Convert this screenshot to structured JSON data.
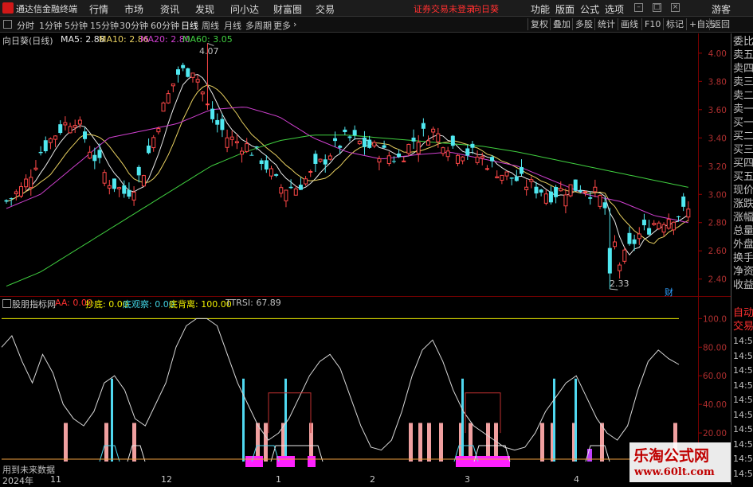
{
  "menubar": {
    "app_title": "通达信金融终端",
    "menus": [
      "行情",
      "市场",
      "资讯",
      "发现",
      "问小达",
      "财富圈",
      "交易"
    ],
    "warning": "证券交易未登录",
    "stock": "向日葵",
    "right": [
      "功能",
      "版面",
      "公式",
      "选项"
    ],
    "guest": "游客"
  },
  "toolbar": {
    "periods": [
      "分时",
      "1分钟",
      "5分钟",
      "15分钟",
      "30分钟",
      "60分钟",
      "日线",
      "周线",
      "月线",
      "多周期",
      "更多"
    ],
    "active_period": "日线",
    "right_buttons": [
      "复权",
      "叠加",
      "多股",
      "统计",
      "画线",
      "F10",
      "标记",
      "+自选",
      "返回"
    ]
  },
  "main_panel": {
    "title": "向日葵(日线)",
    "ma_legend": [
      {
        "label": "MA5: 2.88",
        "color": "#e8e8e8"
      },
      {
        "label": "MA10: 2.86",
        "color": "#e8d060"
      },
      {
        "label": "MA20: 2.80",
        "color": "#d040d0"
      },
      {
        "label": "MA60: 3.05",
        "color": "#40d040"
      }
    ],
    "high_label": "4.07",
    "low_label": "2.33",
    "y_ticks": [
      "4.00",
      "3.80",
      "3.60",
      "3.40",
      "3.20",
      "3.00",
      "2.80",
      "2.60",
      "2.40"
    ],
    "marker": "财"
  },
  "indicator_panel": {
    "name": "股朋指标网",
    "items": [
      {
        "label": "AA: 0.00",
        "color": "#ff3030"
      },
      {
        "label": "抄底: 0.00",
        "color": "#f0f000"
      },
      {
        "label": "底观察: 0.00",
        "color": "#40d0e0"
      },
      {
        "label": "底背离: 100.00",
        "color": "#f0f000"
      },
      {
        "label": "TTRSI: 67.89",
        "color": "#c0c0c0"
      }
    ],
    "y_ticks": [
      "100.0",
      "80.00",
      "60.00",
      "40.00",
      "20.00"
    ],
    "footer": "用到未来数据"
  },
  "x_axis": {
    "labels": [
      "2024年",
      "11",
      "12",
      "1",
      "2",
      "3",
      "4"
    ]
  },
  "right_panel": {
    "quote_labels": [
      "委比",
      "卖五",
      "卖四",
      "卖三",
      "卖二",
      "卖一",
      "买一",
      "买二",
      "买三",
      "买四",
      "买五",
      "现价",
      "涨跌",
      "涨幅",
      "总量",
      "外盘",
      "换手",
      "净资",
      "收益"
    ],
    "auto_trade": [
      "自动",
      "交易"
    ],
    "times": [
      "14:56",
      "14:56",
      "14:56",
      "14:56",
      "14:56",
      "14:56",
      "14:56",
      "14:56",
      "14:56",
      "14:56"
    ]
  },
  "watermark": {
    "line1": "乐淘公式网",
    "line2": "www.60lt.com"
  },
  "chart_data": [
    {
      "type": "candlestick",
      "title": "向日葵(日线)",
      "ylim": [
        2.28,
        4.14
      ],
      "x": [
        "2024-10-28",
        "2024-11-01",
        "2024-12-02",
        "2025-01-02",
        "2025-02-05",
        "2025-03-03",
        "2025-04-01"
      ],
      "annotations": {
        "high": 4.07,
        "low": 2.33
      },
      "series": [
        {
          "name": "MA5",
          "values": [
            2.88
          ]
        },
        {
          "name": "MA10",
          "values": [
            2.86
          ]
        },
        {
          "name": "MA20",
          "values": [
            2.8
          ]
        },
        {
          "name": "MA60",
          "values": [
            3.05
          ]
        }
      ],
      "close_trend": [
        2.95,
        3.05,
        3.3,
        3.45,
        3.55,
        3.3,
        3.1,
        3.0,
        3.15,
        3.55,
        3.85,
        3.9,
        3.55,
        3.4,
        3.35,
        3.25,
        3.05,
        3.05,
        3.15,
        3.3,
        3.4,
        3.35,
        3.3,
        3.25,
        3.4,
        3.45,
        3.35,
        3.3,
        3.25,
        3.15,
        3.1,
        3.05,
        3.0,
        3.05,
        3.05,
        2.95,
        2.5,
        2.7,
        2.8,
        2.85,
        2.88
      ],
      "ma60_trend": [
        2.35,
        2.45,
        2.6,
        2.75,
        2.9,
        3.05,
        3.2,
        3.3,
        3.38,
        3.42,
        3.42,
        3.4,
        3.38,
        3.36,
        3.34,
        3.3,
        3.25,
        3.2,
        3.15,
        3.1,
        3.05
      ],
      "ma20_trend": [
        2.9,
        3.0,
        3.2,
        3.4,
        3.45,
        3.5,
        3.6,
        3.62,
        3.55,
        3.4,
        3.3,
        3.25,
        3.28,
        3.3,
        3.25,
        3.2,
        3.1,
        3.0,
        2.95,
        2.85,
        2.8
      ],
      "ylabel": ""
    },
    {
      "type": "line",
      "title": "股朋指标网",
      "ylim": [
        0,
        108
      ],
      "series": [
        {
          "name": "TTRSI",
          "values": [
            80,
            88,
            70,
            55,
            75,
            62,
            40,
            30,
            25,
            35,
            55,
            60,
            50,
            30,
            25,
            40,
            55,
            80,
            95,
            100,
            100,
            95,
            75,
            55,
            40,
            25,
            15,
            20,
            30,
            45,
            60,
            70,
            75,
            65,
            45,
            25,
            10,
            8,
            15,
            35,
            60,
            78,
            85,
            70,
            50,
            35,
            25,
            20,
            15,
            10,
            8,
            10,
            20,
            35,
            45,
            55,
            60,
            45,
            30,
            20,
            15,
            25,
            50,
            70,
            78,
            72,
            67.89
          ]
        },
        {
          "name": "AA",
          "values": [
            0
          ]
        },
        {
          "name": "抄底",
          "values": [
            0
          ]
        },
        {
          "name": "底观察",
          "values": [
            0
          ]
        },
        {
          "name": "底背离",
          "values": [
            100
          ]
        }
      ],
      "ylabel": ""
    }
  ]
}
